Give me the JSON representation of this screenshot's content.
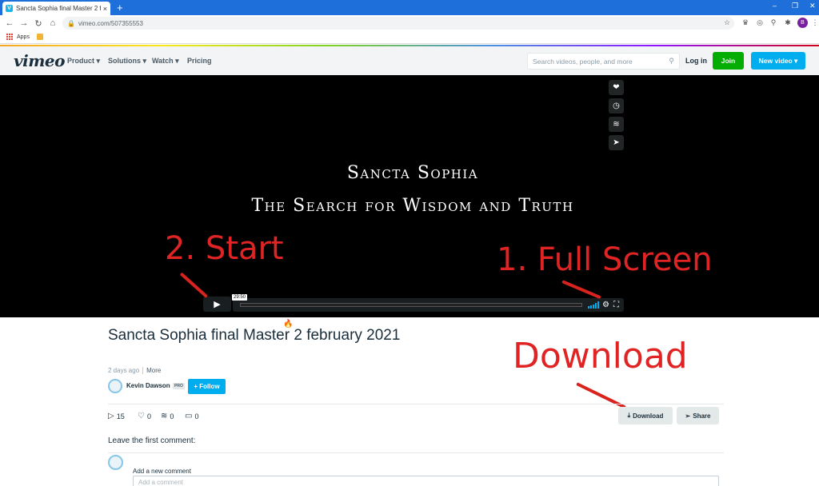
{
  "browser": {
    "tab_title": "Sancta Sophia final Master 2 feb",
    "tab_favicon": "V",
    "tab_close": "×",
    "new_tab": "+",
    "url": "vimeo.com/507355553",
    "bookmarks": [
      {
        "label": "Apps"
      }
    ],
    "profile_initial": "B",
    "window_controls": [
      "–",
      "❐",
      "✕"
    ]
  },
  "header": {
    "logo": "vimeo",
    "nav": [
      "Product ▾",
      "Solutions ▾",
      "Watch ▾",
      "Pricing"
    ],
    "search_placeholder": "Search videos, people, and more",
    "login": "Log in",
    "join": "Join",
    "new_video": "New video ▾"
  },
  "player": {
    "title_line1": "Sancta Sophia",
    "title_line2": "The Search for Wisdom and Truth",
    "time": "29:50",
    "progress_fraction": 0.0,
    "accent": "#00adef"
  },
  "annotations": {
    "start": "2. Start",
    "fullscreen": "1. Full Screen",
    "download": "Download",
    "color": "#e02424"
  },
  "video": {
    "title": "Sancta Sophia final Master 2 february 2021",
    "posted": "2 days ago",
    "more": "More",
    "author": "Kevin Dawson",
    "author_badge": "PRO",
    "follow": "+ Follow",
    "stats": {
      "plays": "15",
      "likes": "0",
      "collections": "0",
      "comments": "0"
    },
    "download": "Download",
    "share": "Share"
  },
  "comments": {
    "leave_first": "Leave the first comment:",
    "add_label": "Add a new comment",
    "placeholder": "Add a comment"
  }
}
